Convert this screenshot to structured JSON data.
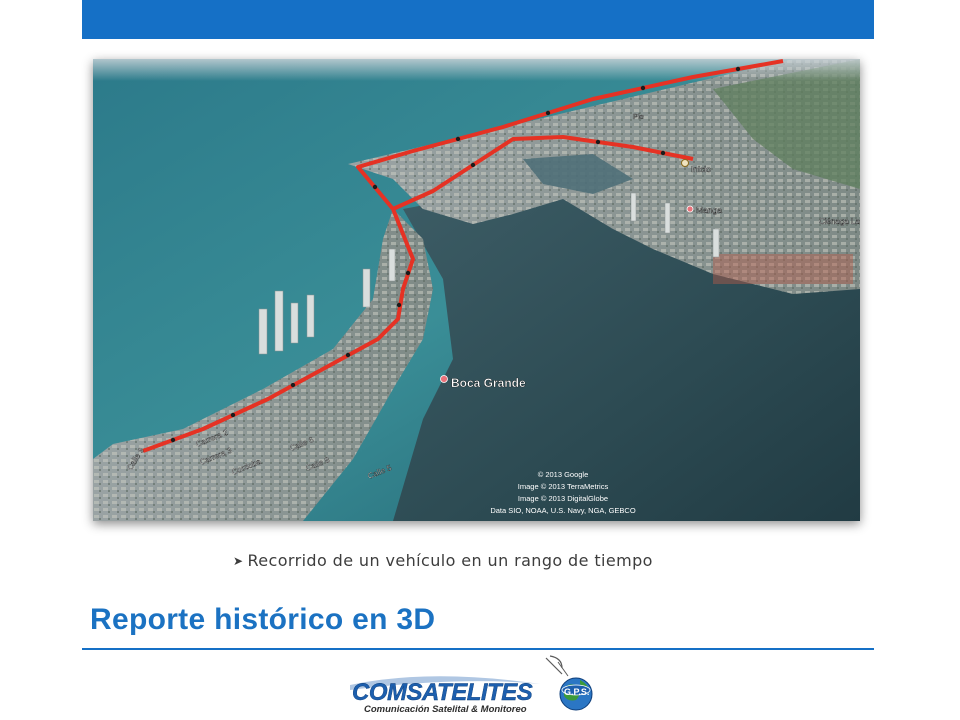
{
  "map": {
    "places": {
      "inicio": "Inicio",
      "manga": "Manga",
      "boca_grande": "Boca Grande",
      "cienaga": "Ciénaga La",
      "pie": "Pie"
    },
    "streets": [
      "Calle 5",
      "Calle 6",
      "Calle 8",
      "Calle 9",
      "Carrera 2",
      "Carrera 3",
      "Cordoba"
    ],
    "attribution": [
      "© 2013 Google",
      "Image © 2013 TerraMetrics",
      "Image © 2013 DigitalGlobe",
      "Data SIO, NOAA, U.S. Navy, NGA, GEBCO"
    ]
  },
  "caption": {
    "bullet": "➤",
    "text": "Recorrido de un vehículo en un rango de tiempo"
  },
  "title": "Reporte histórico en 3D",
  "logo": {
    "name": "COMSATELITES",
    "badge": "G.P.S.",
    "tagline": "Comunicación Satelital & Monitoreo"
  },
  "colors": {
    "accent": "#1570c6",
    "title": "#1b72c2",
    "route": "#e53224"
  }
}
